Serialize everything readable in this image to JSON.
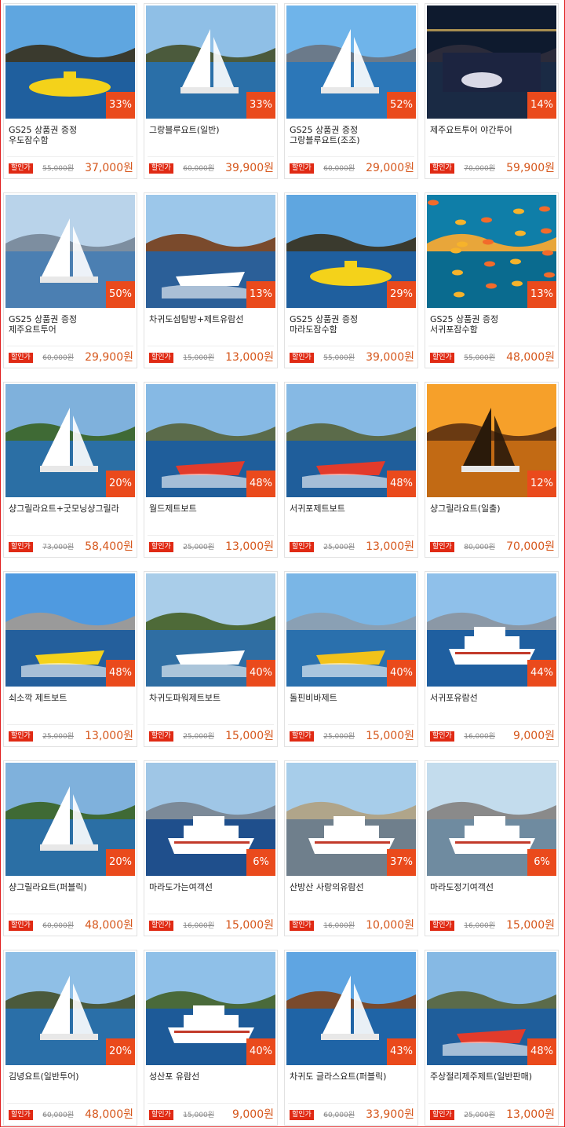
{
  "badge_label": "할인가",
  "colors": {
    "discount_badge": "#ea4a1c",
    "price": "#d6571c",
    "sale_label": "#e02a14",
    "frame": "#e02020"
  },
  "products": [
    {
      "title": "GS25 상품권 증정\n우도잠수함",
      "discount": "33%",
      "original_price": "55,000원",
      "sale_price": "37,000원",
      "image_icon": "yellow-submarine-icon"
    },
    {
      "title": "그랑블루요트(일반)",
      "discount": "33%",
      "original_price": "60,000원",
      "sale_price": "39,900원",
      "image_icon": "catamaran-icon"
    },
    {
      "title": "GS25 상품권 증정\n그랑블루요트(조조)",
      "discount": "52%",
      "original_price": "60,000원",
      "sale_price": "29,000원",
      "image_icon": "sailboat-icon"
    },
    {
      "title": "제주요트투어 야간투어",
      "discount": "14%",
      "original_price": "70,000원",
      "sale_price": "59,900원",
      "image_icon": "night-yacht-icon"
    },
    {
      "title": "GS25 상품권 증정\n제주요트투어",
      "discount": "50%",
      "original_price": "60,000원",
      "sale_price": "29,900원",
      "image_icon": "sailing-couple-icon"
    },
    {
      "title": "차귀도섬탐방+제트유람선",
      "discount": "13%",
      "original_price": "15,000원",
      "sale_price": "13,000원",
      "image_icon": "jet-cruiser-icon"
    },
    {
      "title": "GS25 상품권 증정\n마라도잠수함",
      "discount": "29%",
      "original_price": "55,000원",
      "sale_price": "39,000원",
      "image_icon": "yellow-submarine-icon"
    },
    {
      "title": "GS25 상품권 증정\n서귀포잠수함",
      "discount": "13%",
      "original_price": "55,000원",
      "sale_price": "48,000원",
      "image_icon": "reef-fish-icon"
    },
    {
      "title": "샹그릴라요트+굿모닝샹그릴라",
      "discount": "20%",
      "original_price": "73,000원",
      "sale_price": "58,400원",
      "image_icon": "catamaran-sail-icon"
    },
    {
      "title": "월드제트보트",
      "discount": "48%",
      "original_price": "25,000원",
      "sale_price": "13,000원",
      "image_icon": "jet-boat-icon"
    },
    {
      "title": "서귀포제트보트",
      "discount": "48%",
      "original_price": "25,000원",
      "sale_price": "13,000원",
      "image_icon": "jet-boat-icon"
    },
    {
      "title": "샹그릴라요트(일출)",
      "discount": "12%",
      "original_price": "80,000원",
      "sale_price": "70,000원",
      "image_icon": "sunset-sailboat-icon"
    },
    {
      "title": "쇠소깍 제트보트",
      "discount": "48%",
      "original_price": "25,000원",
      "sale_price": "13,000원",
      "image_icon": "lighthouse-jetboat-icon"
    },
    {
      "title": "차귀도파워제트보트",
      "discount": "40%",
      "original_price": "25,000원",
      "sale_price": "15,000원",
      "image_icon": "power-jetboat-icon"
    },
    {
      "title": "돌핀비바제트",
      "discount": "40%",
      "original_price": "25,000원",
      "sale_price": "15,000원",
      "image_icon": "viva-jet-icon"
    },
    {
      "title": "서귀포유람선",
      "discount": "44%",
      "original_price": "16,000원",
      "sale_price": "9,000원",
      "image_icon": "ferry-icon"
    },
    {
      "title": "샹그릴라요트(퍼블릭)",
      "discount": "20%",
      "original_price": "60,000원",
      "sale_price": "48,000원",
      "image_icon": "catamaran-sail-icon"
    },
    {
      "title": "마라도가는여객선",
      "discount": "6%",
      "original_price": "16,000원",
      "sale_price": "15,000원",
      "image_icon": "passenger-ship-icon"
    },
    {
      "title": "산방산 사랑의유람선",
      "discount": "37%",
      "original_price": "16,000원",
      "sale_price": "10,000원",
      "image_icon": "docked-ship-icon"
    },
    {
      "title": "마라도정기여객선",
      "discount": "6%",
      "original_price": "16,000원",
      "sale_price": "15,000원",
      "image_icon": "boarding-ship-icon"
    },
    {
      "title": "김녕요트(일반투어)",
      "discount": "20%",
      "original_price": "60,000원",
      "sale_price": "48,000원",
      "image_icon": "catamaran-icon"
    },
    {
      "title": "성산포 유람선",
      "discount": "40%",
      "original_price": "15,000원",
      "sale_price": "9,000원",
      "image_icon": "cruise-ship-icon"
    },
    {
      "title": "차귀도 글라스요트(퍼블릭)",
      "discount": "43%",
      "original_price": "60,000원",
      "sale_price": "33,900원",
      "image_icon": "rock-sailboat-icon"
    },
    {
      "title": "주상절리제주제트(일반판매)",
      "discount": "48%",
      "original_price": "25,000원",
      "sale_price": "13,000원",
      "image_icon": "jet-boat-icon"
    }
  ]
}
